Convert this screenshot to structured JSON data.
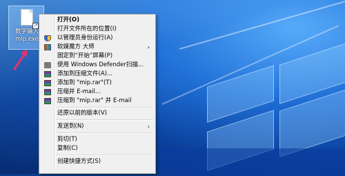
{
  "desktop": {
    "icon_label": "数字输入 mip.exe"
  },
  "context_menu": {
    "items": [
      {
        "label": "打开(O)",
        "bold": true
      },
      {
        "label": "打开文件所在的位置(I)"
      },
      {
        "label": "以管理员身份运行(A)",
        "icon": "shield-icon"
      },
      {
        "label": "软媒魔方 大师",
        "icon": "cube-icon",
        "submenu": true
      },
      {
        "label": "固定到“开始”屏幕(P)"
      },
      {
        "label": "使用 Windows Defender扫描...",
        "icon": "defender-icon"
      },
      {
        "label": "添加到压缩文件(A)...",
        "icon": "winrar-icon"
      },
      {
        "label": "添加到 \"mip.rar\"(T)",
        "icon": "winrar-icon"
      },
      {
        "label": "压缩并 E-mail...",
        "icon": "winrar-icon"
      },
      {
        "label": "压缩到 \"mip.rar\" 并 E-mail",
        "icon": "winrar-icon"
      },
      {
        "label": "还原以前的版本(V)"
      },
      {
        "label": "发送到(N)",
        "submenu": true
      },
      {
        "label": "剪切(T)"
      },
      {
        "label": "复制(C)"
      },
      {
        "label": "创建快捷方式(S)"
      }
    ],
    "submenu_arrow": "›"
  },
  "colors": {
    "menu_bg": "#f0f0f0",
    "desktop_blue": "#0b3d8a",
    "annotation_arrow": "#e8336b"
  }
}
